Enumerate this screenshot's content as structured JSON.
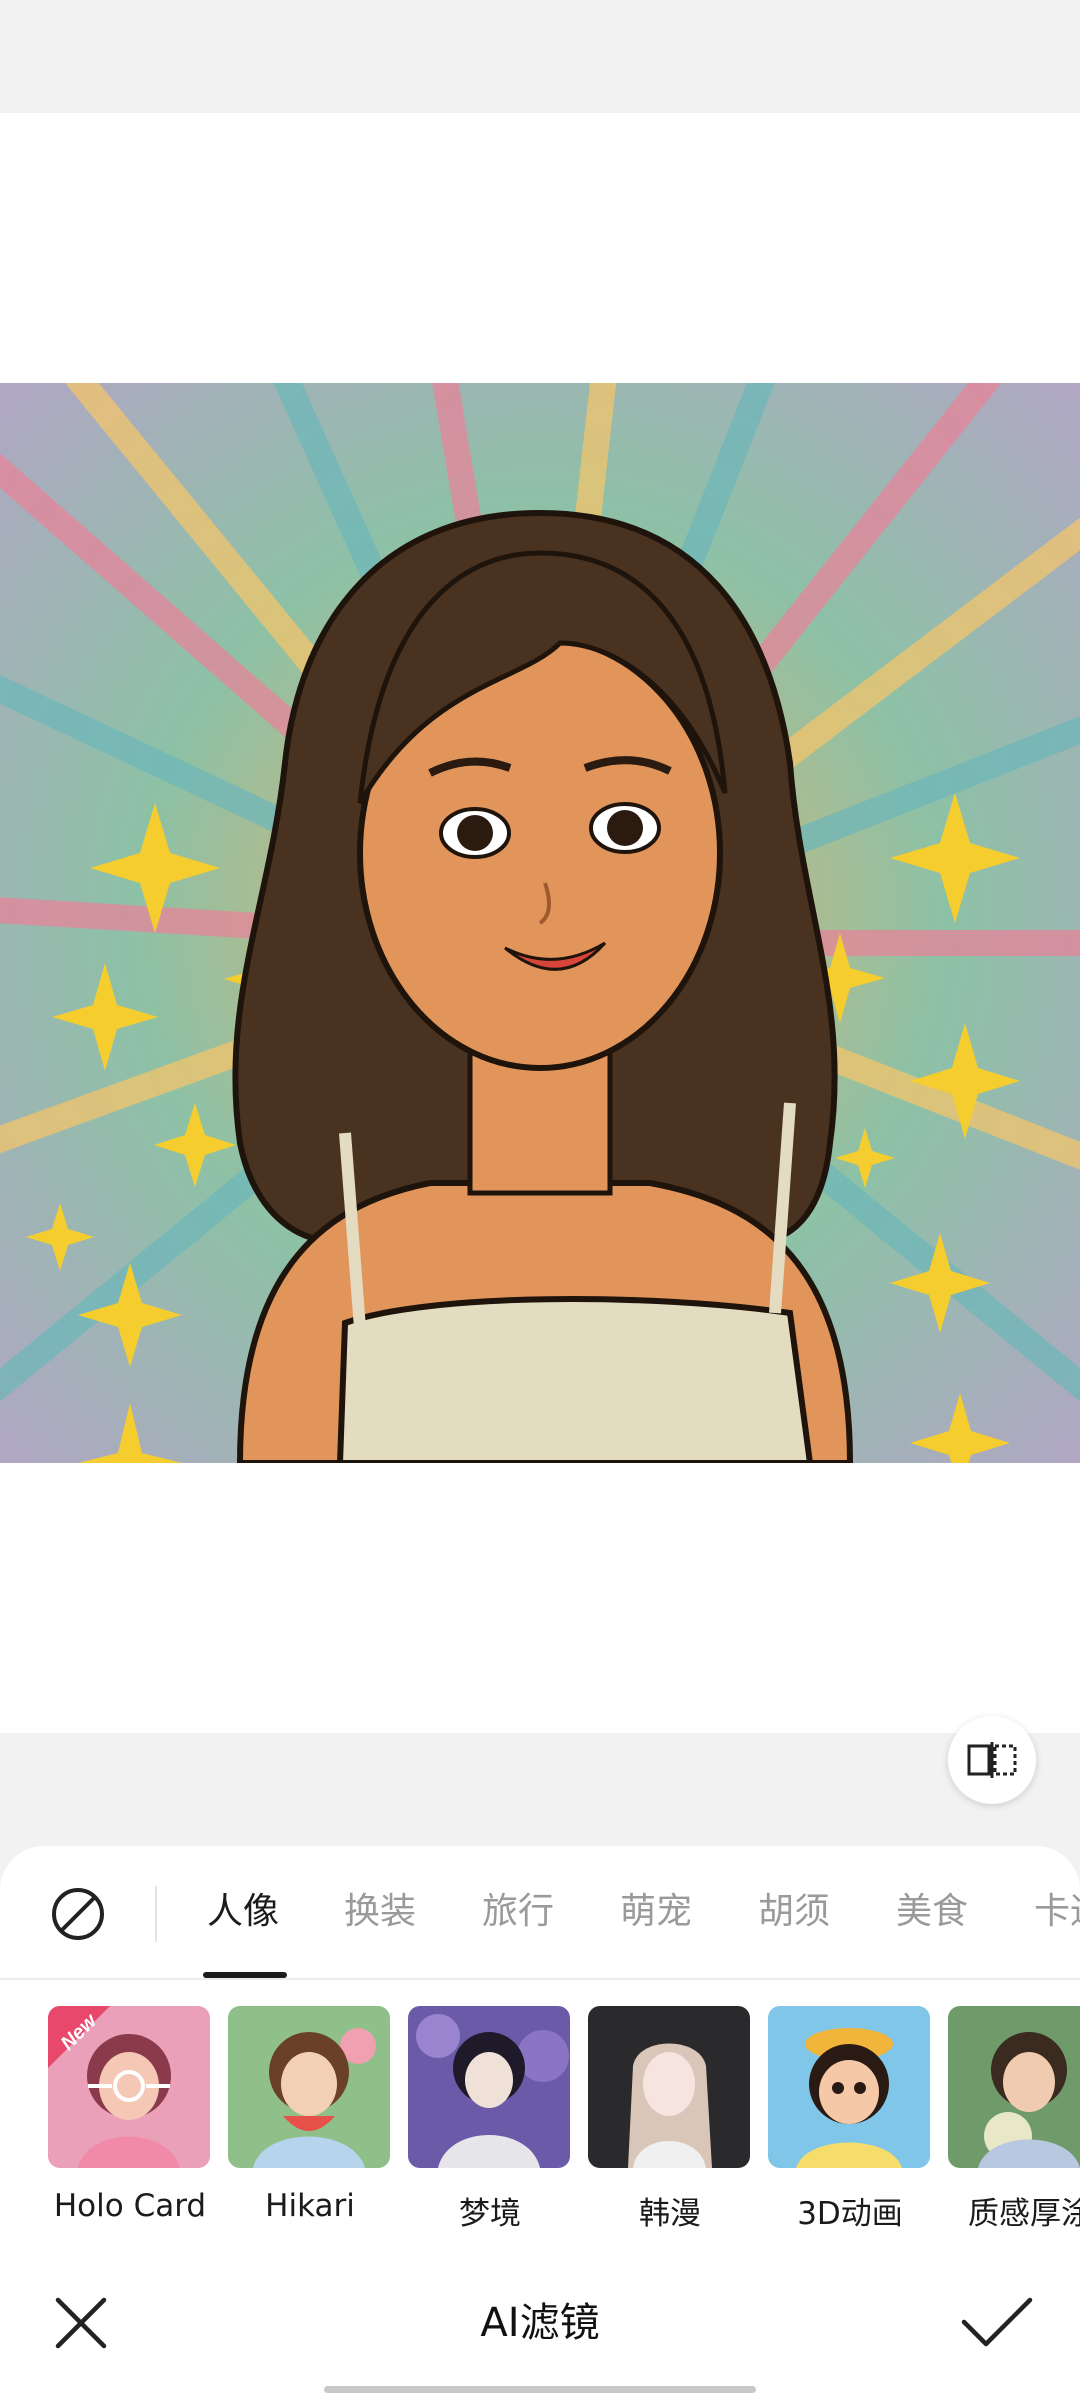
{
  "editor": {
    "title": "AI滤镜",
    "compare_icon": "compare-split-icon",
    "close_icon": "close-icon",
    "confirm_icon": "checkmark-icon",
    "none_icon": "no-filter-icon"
  },
  "tabs": [
    {
      "label": "人像",
      "active": true
    },
    {
      "label": "换装",
      "active": false
    },
    {
      "label": "旅行",
      "active": false
    },
    {
      "label": "萌宠",
      "active": false
    },
    {
      "label": "胡须",
      "active": false
    },
    {
      "label": "美食",
      "active": false
    },
    {
      "label": "卡通",
      "active": false
    }
  ],
  "filters": [
    {
      "label": "Holo Card",
      "badge": "New",
      "selected": true
    },
    {
      "label": "Hikari"
    },
    {
      "label": "梦境"
    },
    {
      "label": "韩漫"
    },
    {
      "label": "3D动画"
    },
    {
      "label": "质感厚涂"
    }
  ],
  "colors": {
    "accent": "#1b1b1b",
    "muted_tab": "#9a9a9a",
    "badge": "#e8486b"
  }
}
